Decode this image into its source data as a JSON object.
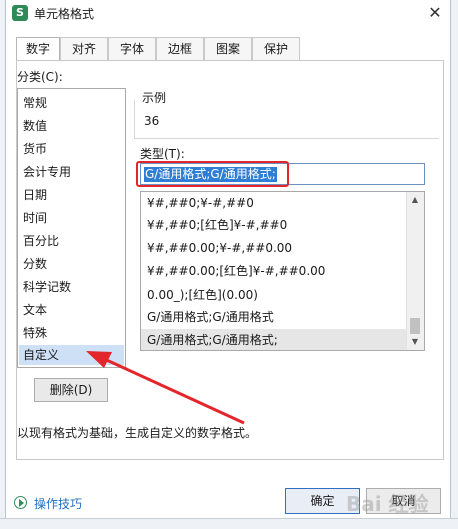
{
  "dialog": {
    "title": "单元格格式",
    "app_icon_glyph": "S",
    "close_glyph": "✕"
  },
  "tabs": [
    "数字",
    "对齐",
    "字体",
    "边框",
    "图案",
    "保护"
  ],
  "category": {
    "label": "分类(C):",
    "items": [
      "常规",
      "数值",
      "货币",
      "会计专用",
      "日期",
      "时间",
      "百分比",
      "分数",
      "科学记数",
      "文本",
      "特殊",
      "自定义"
    ],
    "selected_index": 11
  },
  "sample": {
    "label": "示例",
    "value": "36"
  },
  "type": {
    "label": "类型(T):",
    "input_value": "G/通用格式;G/通用格式;"
  },
  "format_list": {
    "items": [
      "¥#,##0;¥-#,##0",
      "¥#,##0;[红色]¥-#,##0",
      "¥#,##0.00;¥-#,##0.00",
      "¥#,##0.00;[红色]¥-#,##0.00",
      "0.00_);[红色](0.00)",
      "G/通用格式;G/通用格式",
      "G/通用格式;G/通用格式;"
    ],
    "selected_index": 6
  },
  "buttons": {
    "delete": "删除(D)",
    "ok": "确定",
    "cancel": "取消"
  },
  "description": "以现有格式为基础，生成自定义的数字格式。",
  "help_link": "操作技巧",
  "watermark": "Bai 经验",
  "annotation_color": "#e3262b"
}
